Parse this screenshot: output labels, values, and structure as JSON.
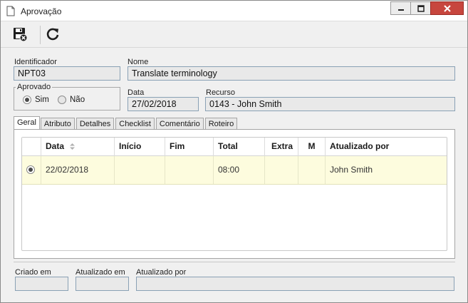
{
  "window": {
    "title": "Aprovação",
    "icon": "document-icon",
    "controls": [
      "minimize-icon",
      "maximize-icon",
      "close-icon"
    ]
  },
  "toolbar": {
    "buttons": [
      {
        "icon": "save-close-icon"
      },
      {
        "icon": "refresh-icon"
      }
    ]
  },
  "form": {
    "identificador": {
      "label": "Identificador",
      "value": "NPT03"
    },
    "nome": {
      "label": "Nome",
      "value": "Translate terminology"
    },
    "aprovado": {
      "label": "Aprovado",
      "options": [
        {
          "label": "Sim",
          "selected": true
        },
        {
          "label": "Não",
          "selected": false
        }
      ]
    },
    "data": {
      "label": "Data",
      "value": "27/02/2018"
    },
    "recurso": {
      "label": "Recurso",
      "value": "0143 - John Smith"
    }
  },
  "tabs": [
    {
      "label": "Geral",
      "active": true
    },
    {
      "label": "Atributo",
      "active": false
    },
    {
      "label": "Detalhes",
      "active": false
    },
    {
      "label": "Checklist",
      "active": false
    },
    {
      "label": "Comentário",
      "active": false
    },
    {
      "label": "Roteiro",
      "active": false
    }
  ],
  "grid": {
    "columns": [
      "",
      "Data",
      "Início",
      "Fim",
      "Total",
      "Extra",
      "M",
      "Atualizado por"
    ],
    "rows": [
      {
        "selected": true,
        "data": "22/02/2018",
        "inicio": "",
        "fim": "",
        "total": "08:00",
        "extra": "",
        "m": "",
        "atualizado_por": "John Smith"
      }
    ]
  },
  "footer": {
    "criado_em": {
      "label": "Criado em",
      "value": ""
    },
    "atualizado_em": {
      "label": "Atualizado em",
      "value": ""
    },
    "atualizado_por": {
      "label": "Atualizado por",
      "value": ""
    }
  },
  "colors": {
    "row_highlight": "#fdfcde",
    "close_button": "#c7463e",
    "field_border": "#8aa1b5"
  }
}
